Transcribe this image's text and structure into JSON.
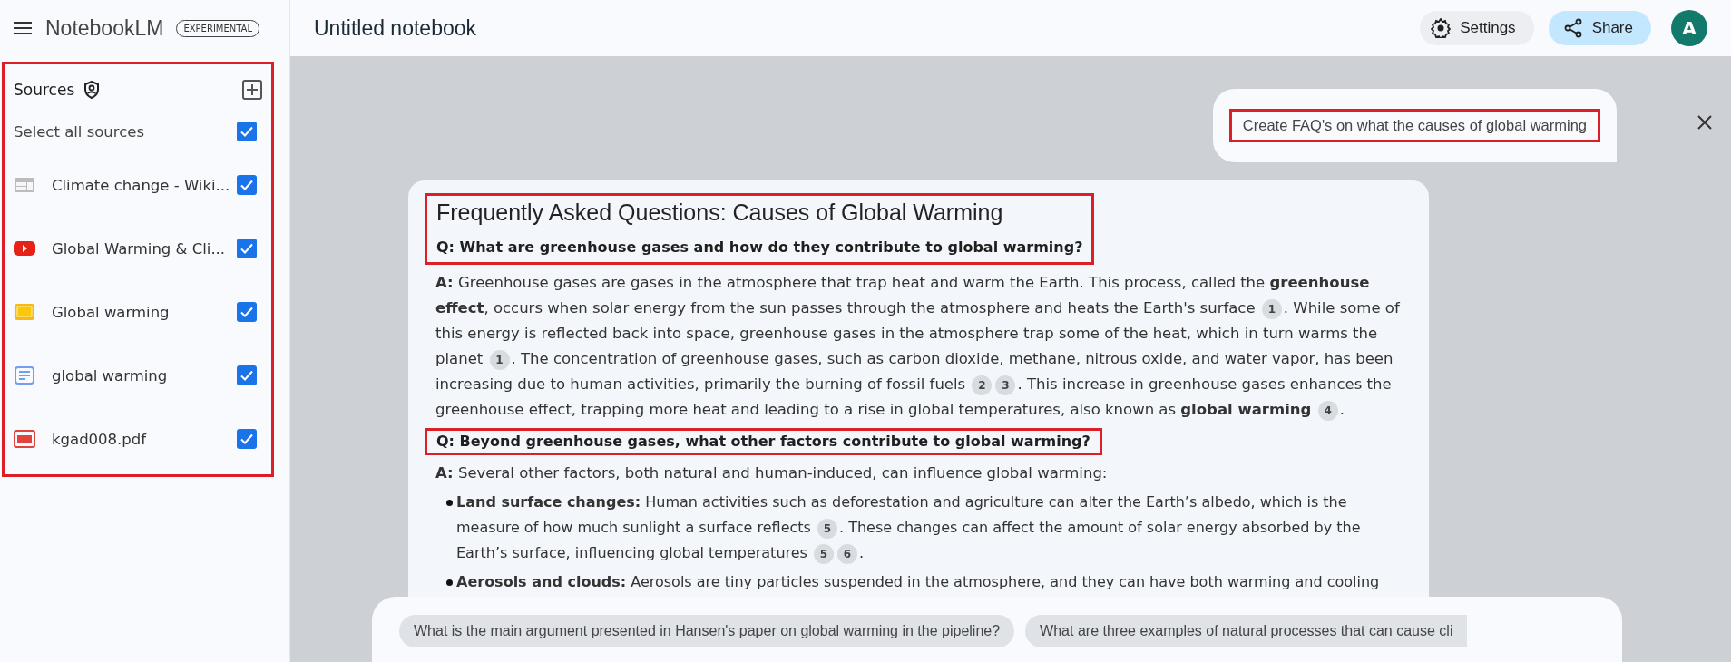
{
  "app": {
    "name": "NotebookLM",
    "badge": "EXPERIMENTAL"
  },
  "notebook": {
    "title": "Untitled notebook"
  },
  "header_buttons": [
    {
      "kind": "settings",
      "label": "Settings"
    },
    {
      "kind": "share",
      "label": "Share"
    }
  ],
  "avatar": {
    "initial": "A",
    "color": "#137a6b"
  },
  "sources": {
    "title": "Sources",
    "highlighted": true,
    "select_all": {
      "label": "Select all sources",
      "checked": true
    },
    "items": [
      {
        "kind": "web",
        "name": "Climate change - Wiki...",
        "checked": true
      },
      {
        "kind": "video",
        "name": "Global Warming & Cli...",
        "checked": true
      },
      {
        "kind": "slides",
        "name": "Global warming",
        "checked": true
      },
      {
        "kind": "doc",
        "name": "global warming",
        "checked": true
      },
      {
        "kind": "pdf",
        "name": "kgad008.pdf",
        "checked": true
      }
    ]
  },
  "user_message": {
    "text": "Create FAQ's on what the causes of global warming",
    "highlighted": true
  },
  "response": {
    "title": "Frequently Asked Questions: Causes of Global Warming",
    "header_highlighted": true,
    "sections": [
      {
        "question": "Q: What are greenhouse gases and how do they contribute to global warming?",
        "answer": [
          {
            "kind": "text",
            "text": "**A:** Greenhouse gases are gases in the atmosphere that trap heat and warm the Earth. This process, called the **greenhouse effect**, occurs when solar energy from the sun passes through the atmosphere and heats the Earth's surface "
          },
          {
            "kind": "cite",
            "text": "1"
          },
          {
            "kind": "text",
            "text": ". While some of this energy is reflected back into space, greenhouse gases in the atmosphere trap some of the heat, which in turn warms the planet "
          },
          {
            "kind": "cite",
            "text": "1"
          },
          {
            "kind": "text",
            "text": ". The concentration of greenhouse gases, such as carbon dioxide, methane, nitrous oxide, and water vapor, has been increasing due to human activities, primarily the burning of fossil fuels "
          },
          {
            "kind": "cite",
            "text": "2"
          },
          {
            "kind": "cite",
            "text": "3"
          },
          {
            "kind": "text",
            "text": ". This increase in greenhouse gases enhances the greenhouse effect, trapping more heat and leading to a rise in global temperatures, also known as **global warming** "
          },
          {
            "kind": "cite",
            "text": "4"
          },
          {
            "kind": "text",
            "text": "."
          }
        ]
      },
      {
        "question": "Q: Beyond greenhouse gases, what other factors contribute to global warming?",
        "highlighted": true,
        "answer": [
          {
            "kind": "text",
            "text": "**A:** Several other factors, both natural and human-induced, can influence global warming:"
          }
        ],
        "bullets": [
          [
            {
              "kind": "text",
              "text": "**Land surface changes:** Human activities such as deforestation and agriculture can alter the Earth’s albedo, which is the measure of how much sunlight a surface reflects "
            },
            {
              "kind": "cite",
              "text": "5"
            },
            {
              "kind": "text",
              "text": ". These changes can affect the amount of solar energy absorbed by the Earth’s surface, influencing global temperatures "
            },
            {
              "kind": "cite",
              "text": "5"
            },
            {
              "kind": "cite",
              "text": "6"
            },
            {
              "kind": "text",
              "text": "."
            }
          ],
          [
            {
              "kind": "text",
              "text": "**Aerosols and clouds:** Aerosols are tiny particles suspended in the atmosphere, and they can have both warming and cooling"
            }
          ]
        ]
      }
    ]
  },
  "suggestions": [
    "What is the main argument presented in Hansen's paper on global warming in the pipeline?",
    "What are three examples of natural processes that can cause cli"
  ]
}
